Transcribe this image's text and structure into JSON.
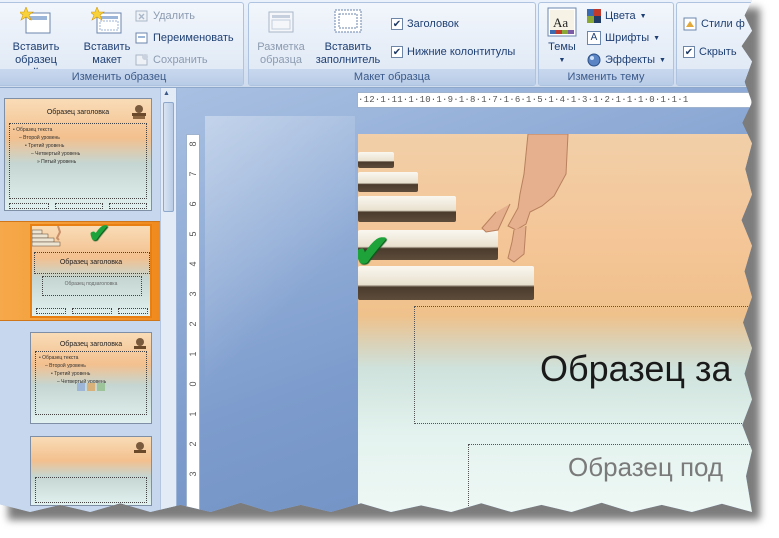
{
  "ribbon": {
    "group_master": {
      "label": "Изменить образец",
      "insert_slide_master": [
        "Вставить",
        "образец слайдов"
      ],
      "insert_layout": [
        "Вставить",
        "макет"
      ],
      "delete": "Удалить",
      "rename": "Переименовать",
      "preserve": "Сохранить"
    },
    "group_layout": {
      "label": "Макет образца",
      "master_layout": [
        "Разметка",
        "образца"
      ],
      "insert_placeholder": [
        "Вставить",
        "заполнитель"
      ],
      "title_checkbox": "Заголовок",
      "footers_checkbox": "Нижние колонтитулы"
    },
    "group_theme": {
      "label": "Изменить тему",
      "themes": "Темы",
      "colors": "Цвета",
      "fonts": "Шрифты",
      "effects": "Эффекты"
    },
    "group_background": {
      "styles": "Стили ф",
      "hide": "Скрыть"
    }
  },
  "ruler_top": "·12·1·11·1·10·1·9·1·8·1·7·1·6·1·5·1·4·1·3·1·2·1·1·1·0·1·1·1",
  "ruler_left": [
    "8",
    "7",
    "6",
    "5",
    "4",
    "3",
    "2",
    "1",
    "0",
    "1",
    "2",
    "3"
  ],
  "thumbnails": [
    {
      "title": "Образец заголовка",
      "lines": [
        "• Образец текста",
        "– Второй уровень",
        "• Третий уровень",
        "– Четвертый уровень",
        "» Пятый уровень"
      ]
    },
    {
      "title": "Образец заголовка",
      "subtitle": "Образец подзаголовка"
    },
    {
      "title": "Образец заголовка",
      "lines": [
        "• Образец текста",
        "– Второй уровень",
        "• Третий уровень",
        "– Четвертый уровень"
      ]
    },
    {
      "title": ""
    }
  ],
  "slide": {
    "title": "Образец за",
    "subtitle": "Образец под"
  },
  "check_mark": "✔",
  "colors": {
    "accent_orange": "#f08a1e",
    "check_green": "#1ea33a"
  }
}
